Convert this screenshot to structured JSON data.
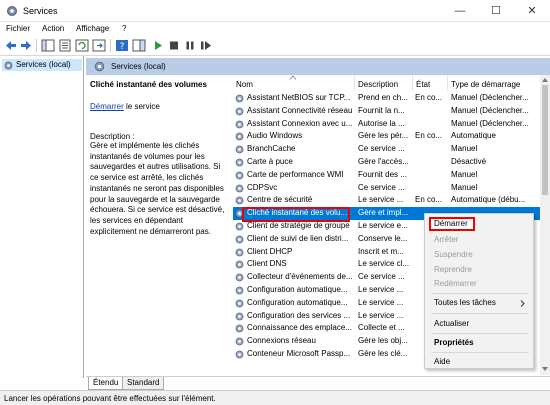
{
  "window": {
    "title": "Services"
  },
  "menu": [
    "Fichier",
    "Action",
    "Affichage",
    "?"
  ],
  "tree": {
    "root": "Services (local)"
  },
  "header": {
    "title": "Services (local)"
  },
  "details": {
    "service_name": "Cliché instantané des volumes",
    "start_link": "Démarrer",
    "start_suffix": " le service",
    "description_label": "Description :",
    "description_text": "Gère et implémente les clichés instantanés de volumes pour les sauvegardes et autres utilisations. Si ce service est arrêté, les clichés instantanés ne seront pas disponibles pour la sauvegarde et la sauvegarde échouera. Si ce service est désactivé, les services en dépendant explicitement ne démarreront pas."
  },
  "columns": [
    "Nom",
    "Description",
    "État",
    "Type de démarrage"
  ],
  "rows": [
    [
      "Assistant NetBIOS sur TCP...",
      "Prend en ch...",
      "En co...",
      "Manuel (Déclencher..."
    ],
    [
      "Assistant Connectivité réseau",
      "Fournit la n...",
      "",
      "Manuel (Déclencher..."
    ],
    [
      "Assistant Connexion avec u...",
      "Autorise la ...",
      "",
      "Manuel (Déclencher..."
    ],
    [
      "Audio Windows",
      "Gère les pér...",
      "En co...",
      "Automatique"
    ],
    [
      "BranchCache",
      "Ce service ...",
      "",
      "Manuel"
    ],
    [
      "Carte à puce",
      "Gère l'accès...",
      "",
      "Désactivé"
    ],
    [
      "Carte de performance WMI",
      "Fournit des ...",
      "",
      "Manuel"
    ],
    [
      "CDPSvc",
      "Ce service ...",
      "",
      "Manuel"
    ],
    [
      "Centre de sécurité",
      "Le service ...",
      "En co...",
      "Automatique (débu..."
    ],
    [
      "Cliché instantané des volu...",
      "Gère et impl...",
      "",
      ""
    ],
    [
      "Client de stratégie de groupe",
      "Le service e...",
      "",
      ""
    ],
    [
      "Client de suivi de lien distri...",
      "Conserve le...",
      "",
      ""
    ],
    [
      "Client DHCP",
      "Inscrit et m...",
      "",
      ""
    ],
    [
      "Client DNS",
      "Le service cl...",
      "",
      ""
    ],
    [
      "Collecteur d'événements de...",
      "Ce service ...",
      "",
      ""
    ],
    [
      "Configuration automatique...",
      "Le service ...",
      "",
      ""
    ],
    [
      "Configuration automatique...",
      "Le service ...",
      "",
      ""
    ],
    [
      "Configuration des services ...",
      "Le service ...",
      "",
      ""
    ],
    [
      "Connaissance des emplace...",
      "Collecte et ...",
      "",
      ""
    ],
    [
      "Connexions réseau",
      "Gère les obj...",
      "",
      ""
    ],
    [
      "Conteneur Microsoft Passp...",
      "Gère les clé...",
      "",
      ""
    ]
  ],
  "context_menu": {
    "start": "Démarrer",
    "stop": "Arrêter",
    "pause": "Suspendre",
    "resume": "Reprendre",
    "restart": "Redémarrer",
    "all_tasks": "Toutes les tâches",
    "refresh": "Actualiser",
    "properties": "Propriétés",
    "help": "Aide"
  },
  "tabs": [
    "Étendu",
    "Standard"
  ],
  "status": "Lancer les opérations pouvant être effectuées sur l'élément.",
  "colors": {
    "accent": "#0078d7",
    "band": "#b9cee6",
    "highlight_box": "#e00000"
  }
}
